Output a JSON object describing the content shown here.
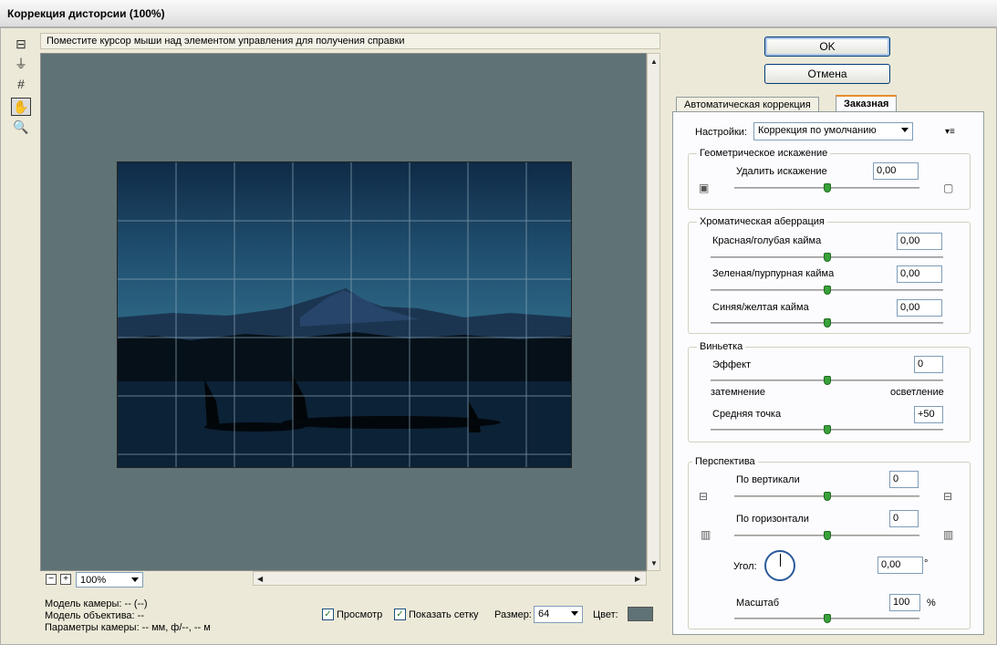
{
  "window": {
    "title": "Коррекция дисторсии (100%)"
  },
  "hint": "Поместите курсор мыши над элементом управления для получения справки",
  "tools": [
    {
      "icon": "remove-distortion-tool-icon",
      "glyph": "⊟"
    },
    {
      "icon": "straighten-tool-icon",
      "glyph": "⏚"
    },
    {
      "icon": "move-grid-tool-icon",
      "glyph": "#"
    },
    {
      "icon": "hand-tool-icon",
      "glyph": "✋"
    },
    {
      "icon": "zoom-tool-icon",
      "glyph": "🔍"
    }
  ],
  "zoom": {
    "minus": "−",
    "plus": "+",
    "value": "100%"
  },
  "camera_info": {
    "model": "Модель камеры: -- (--)",
    "lens": "Модель объектива: --",
    "params": "Параметры камеры: -- мм, ф/--, -- м"
  },
  "bottom_bar": {
    "preview_label": "Просмотр",
    "preview_checked": true,
    "show_grid_label": "Показать сетку",
    "show_grid_checked": true,
    "size_label": "Размер:",
    "size_value": "64",
    "color_label": "Цвет:",
    "grid_color": "#5f7275",
    "check_mark": "✓"
  },
  "buttons": {
    "ok": "OK",
    "cancel": "Отмена"
  },
  "tabs": [
    {
      "label": "Автоматическая коррекция",
      "selected": false
    },
    {
      "label": "Заказная",
      "selected": true
    }
  ],
  "settings": {
    "label": "Настройки:",
    "value": "Коррекция по умолчанию",
    "menu_glyph": "▾≡"
  },
  "geometric": {
    "title": "Геометрическое искажение",
    "remove_label": "Удалить искажение",
    "remove_value": "0,00"
  },
  "chromatic": {
    "title": "Хроматическая аберрация",
    "red_cyan_label": "Красная/голубая кайма",
    "red_cyan_value": "0,00",
    "green_magenta_label": "Зеленая/пурпурная кайма",
    "green_magenta_value": "0,00",
    "blue_yellow_label": "Синяя/желтая кайма",
    "blue_yellow_value": "0,00"
  },
  "vignette": {
    "title": "Виньетка",
    "amount_label": "Эффект",
    "amount_value": "0",
    "darken_label": "затемнение",
    "lighten_label": "осветление",
    "midpoint_label": "Средняя точка",
    "midpoint_value": "+50"
  },
  "perspective": {
    "title": "Перспектива",
    "vertical_label": "По вертикали",
    "vertical_value": "0",
    "horizontal_label": "По горизонтали",
    "horizontal_value": "0",
    "angle_label": "Угол:",
    "angle_value": "0,00",
    "angle_unit": "°",
    "scale_label": "Масштаб",
    "scale_value": "100",
    "scale_unit": "%"
  },
  "colors": {
    "accent": "#e68b2c",
    "slider_thumb": "#3aa23a",
    "canvas_bg": "#5f7275"
  }
}
